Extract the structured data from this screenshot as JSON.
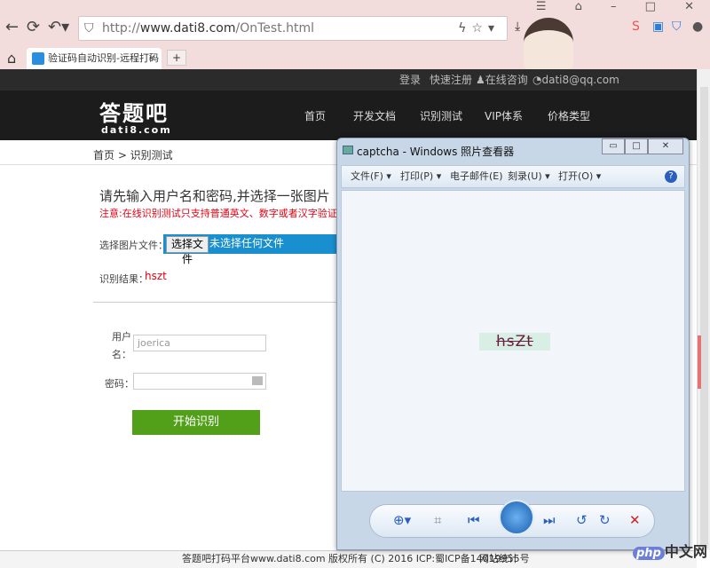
{
  "browser": {
    "url_scheme": "http://",
    "url_host": "www.dati8.com",
    "url_path": "/OnTest.html",
    "tab_title": "验证码自动识别-远程打码",
    "new_tab": "+"
  },
  "site": {
    "topbar": {
      "login": "登录",
      "register": "快速注册",
      "consult": "在线咨询",
      "email": "dati8@qq.com"
    },
    "logo": "答题吧",
    "logo_sub": "dati8.com",
    "nav": [
      "首页",
      "开发文档",
      "识别测试",
      "VIP体系",
      "价格类型"
    ],
    "breadcrumb": "首页 > 识别测试",
    "heading": "请先输入用户名和密码,并选择一张图片",
    "notice": "注意:在线识别测试只支持普通英文、数字或者汉字验证码、选择",
    "file_label": "选择图片文件：",
    "file_button": "选择文件",
    "file_status": "未选择任何文件",
    "result_label": "识别结果：",
    "result_value": "hszt",
    "username_label": "用户名：",
    "username_value": "joerica",
    "password_label": "密码：",
    "submit": "开始识别",
    "footer": "答题吧打码平台www.dati8.com 版权所有 (C) 2016 ICP:蜀ICP备14019955号",
    "footer_stats": "网站统计"
  },
  "viewer": {
    "title": "captcha - Windows 照片查看器",
    "menu": [
      "文件(F) ▾",
      "打印(P) ▾",
      "电子邮件(E)",
      "刻录(U) ▾",
      "打开(O) ▾"
    ],
    "captcha_text": "hsZt"
  },
  "watermark": {
    "logo": "php",
    "text": "中文网"
  }
}
